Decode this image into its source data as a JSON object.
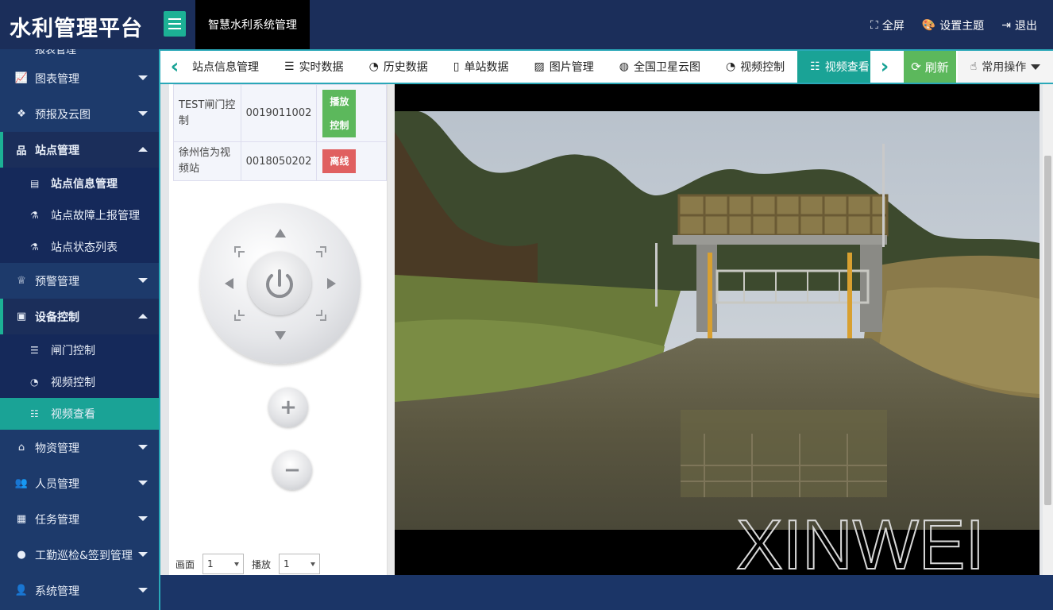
{
  "header": {
    "brand": "水利管理平台",
    "system_tab": "智慧水利系统管理",
    "actions": [
      {
        "icon": "fullscreen-icon",
        "label": "全屏"
      },
      {
        "icon": "palette-icon",
        "label": "设置主题"
      },
      {
        "icon": "logout-icon",
        "label": "退出"
      }
    ]
  },
  "sidebar": {
    "top_cut_label": "报表管理",
    "chart": "图表管理",
    "forecast": "预报及云图",
    "station": "站点管理",
    "station_info": "站点信息管理",
    "station_fault": "站点故障上报管理",
    "station_status": "站点状态列表",
    "warning": "预警管理",
    "device": "设备控制",
    "gate_control": "闸门控制",
    "video_control": "视频控制",
    "video_view": "视频查看",
    "material": "物资管理",
    "personnel": "人员管理",
    "task": "任务管理",
    "patrol": "工勤巡检&签到管理",
    "system": "系统管理"
  },
  "tabs": {
    "station_info": "站点信息管理",
    "realtime": "实时数据",
    "history": "历史数据",
    "single": "单站数据",
    "images": "图片管理",
    "satellite": "全国卫星云图",
    "video_control": "视频控制",
    "video_view": "视频查看"
  },
  "toolbar": {
    "refresh": "刷新",
    "common_ops": "常用操作"
  },
  "devices": [
    {
      "name": "TEST闸门控制",
      "code": "0019011002",
      "btn_line1": "播放",
      "btn_line2": "控制",
      "status_color": "#5cb85c"
    },
    {
      "name": "徐州信为视频站",
      "code": "0018050202",
      "btn": "离线",
      "status_color": "#e06060"
    }
  ],
  "controls": {
    "screen_label": "画面",
    "screen_value": "1",
    "play_label": "播放",
    "play_value": "1"
  },
  "video": {
    "watermark": "XINWEI"
  }
}
